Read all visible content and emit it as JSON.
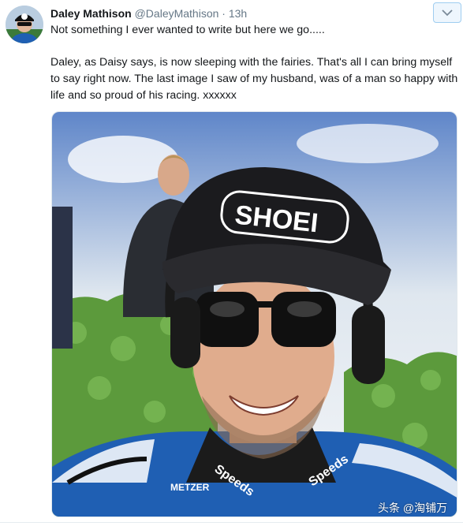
{
  "tweet": {
    "author_name": "Daley Mathison",
    "author_handle": "@DaleyMathison",
    "separator": "·",
    "time": "13h",
    "lines": [
      "Not something I ever wanted to write but here we go.....",
      "Daley, as Daisy says, is now sleeping with the fairies. That's all I can bring myself",
      "to say right now. The last image I saw of my husband, was of a man so happy with",
      "life and so proud of his racing. xxxxxx"
    ]
  },
  "media": {
    "cap_brand": "SHOEI",
    "suit_brand_left": "Speeds",
    "suit_brand_right": "Speeds",
    "suit_sponsor": "METZER"
  },
  "watermark": {
    "text": "头条 @淘铺万"
  },
  "colors": {
    "accent": "#1da1f2",
    "text": "#14171a",
    "secondary": "#657786",
    "suit_blue": "#1f5fb3"
  },
  "icons": {
    "caret": "chevron-down-icon"
  }
}
